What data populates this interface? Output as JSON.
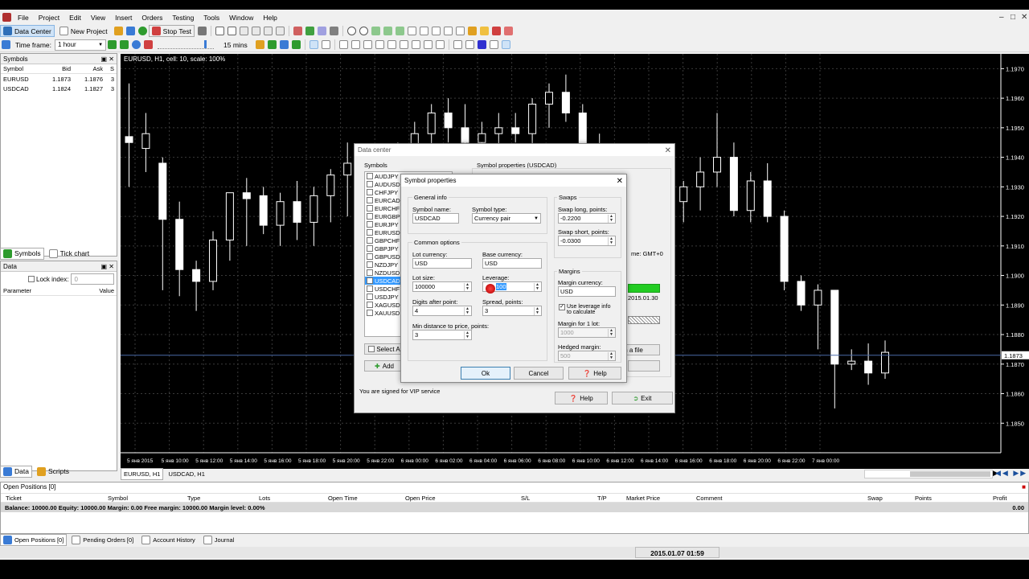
{
  "menu": [
    "File",
    "Project",
    "Edit",
    "View",
    "Insert",
    "Orders",
    "Testing",
    "Tools",
    "Window",
    "Help"
  ],
  "toolbar": {
    "data_center": "Data Center",
    "new_project": "New Project",
    "stop_test": "Stop Test",
    "timeframe_label": "Time frame:",
    "timeframe_value": "1 hour",
    "speed_value": "15 mins"
  },
  "symbols_panel": {
    "title": "Symbols",
    "headers": [
      "Symbol",
      "Bid",
      "Ask",
      "S"
    ],
    "rows": [
      [
        "EURUSD",
        "1.1873",
        "1.1876",
        "3"
      ],
      [
        "USDCAD",
        "1.1824",
        "1.1827",
        "3"
      ]
    ],
    "tabs": [
      "Symbols",
      "Tick chart"
    ]
  },
  "data_panel": {
    "title": "Data",
    "lock_index": "Lock index:",
    "lock_value": "0",
    "col_param": "Parameter",
    "col_value": "Value",
    "tabs": [
      "Data",
      "Scripts"
    ]
  },
  "chart": {
    "title": "EURUSD, H1, cell: 10, scale: 100%",
    "price_labels": [
      "1.1970",
      "1.1960",
      "1.1950",
      "1.1940",
      "1.1930",
      "1.1920",
      "1.1910",
      "1.1900",
      "1.1890",
      "1.1880",
      "1.1870",
      "1.1860",
      "1.1850"
    ],
    "current_price": "1.1873",
    "time_labels": [
      "5 янв 2015",
      "5 янв 10:00",
      "5 янв 12:00",
      "5 янв 14:00",
      "5 янв 16:00",
      "5 янв 18:00",
      "5 янв 20:00",
      "5 янв 22:00",
      "6 янв 00:00",
      "6 янв 02:00",
      "6 янв 04:00",
      "6 янв 06:00",
      "6 янв 08:00",
      "6 янв 10:00",
      "6 янв 12:00",
      "6 янв 14:00",
      "6 янв 16:00",
      "6 янв 18:00",
      "6 янв 20:00",
      "6 янв 22:00",
      "7 янв 00:00"
    ],
    "tabs": [
      "EURUSD, H1",
      "USDCAD, H1"
    ]
  },
  "data_center": {
    "title": "Data center",
    "symbols_label": "Symbols",
    "symbols": [
      "AUDJPY",
      "AUDUSD",
      "CHFJPY",
      "EURCAD",
      "EURCHF",
      "EURGBP",
      "EURJPY",
      "EURUSD",
      "GBPCHF",
      "GBPJPY",
      "GBPUSD",
      "NZDJPY",
      "NZDUSD",
      "USDCAD",
      "USDCHF",
      "USDJPY",
      "XAGUSD",
      "XAUUSD"
    ],
    "selected": "USDCAD",
    "props_title": "Symbol properties (USDCAD)",
    "select_all": "Select A",
    "add": "Add",
    "time_zone": "me: GMT+0",
    "date": "2015.01.30",
    "from_file": "n a file",
    "signed": "You are signed for VIP service",
    "help": "Help",
    "exit": "Exit"
  },
  "symbol_props": {
    "title": "Symbol properties",
    "general": "General info",
    "symbol_name_label": "Symbol name:",
    "symbol_name": "USDCAD",
    "symbol_type_label": "Symbol type:",
    "symbol_type": "Currency pair",
    "common": "Common options",
    "lot_currency_label": "Lot currency:",
    "lot_currency": "USD",
    "base_currency_label": "Base currency:",
    "base_currency": "USD",
    "lot_size_label": "Lot size:",
    "lot_size": "100000",
    "leverage_label": "Leverage:",
    "leverage": "100",
    "digits_label": "Digits after point:",
    "digits": "4",
    "spread_label": "Spread, points:",
    "spread": "3",
    "min_dist_label": "Min distance to price, points:",
    "min_dist": "3",
    "swaps": "Swaps",
    "swap_long_label": "Swap long, points:",
    "swap_long": "-0.2200",
    "swap_short_label": "Swap short, points:",
    "swap_short": "-0.0300",
    "margins": "Margins",
    "margin_currency_label": "Margin currency:",
    "margin_currency": "USD",
    "use_leverage": "Use leverage info to calculate",
    "margin_1lot_label": "Margin for 1 lot:",
    "margin_1lot": "1000",
    "hedged_label": "Hedged margin:",
    "hedged": "500",
    "ok": "Ok",
    "cancel": "Cancel",
    "help": "Help"
  },
  "positions": {
    "title": "Open Positions [0]",
    "headers": [
      "Ticket",
      "Symbol",
      "Type",
      "Lots",
      "Open Time",
      "Open Price",
      "S/L",
      "T/P",
      "Market Price",
      "Comment",
      "Swap",
      "Points",
      "Profit"
    ],
    "balance": "Balance: 10000.00 Equity: 10000.00 Margin: 0.00 Free margin: 10000.00 Margin level: 0.00%",
    "profit_total": "0.00",
    "tabs": [
      "Open Positions [0]",
      "Pending Orders [0]",
      "Account History",
      "Journal"
    ]
  },
  "status": {
    "datetime": "2015.01.07 01:59"
  },
  "colors": {
    "candle_up": "#ffffff",
    "candle_down": "#ffffff",
    "chart_bg": "#000000",
    "grid": "#2a2a2a",
    "accent": "#3399ff",
    "progress": "#22cc22"
  }
}
